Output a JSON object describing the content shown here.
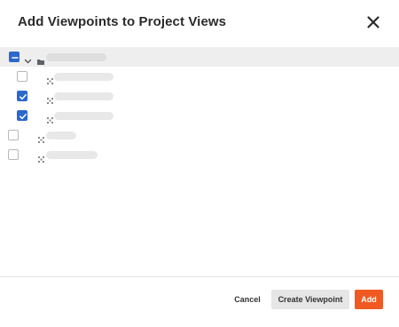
{
  "dialog": {
    "title": "Add Viewpoints to Project Views"
  },
  "tree": {
    "root": {
      "state": "indeterminate",
      "expanded": true,
      "icon": "folder-icon"
    },
    "children": [
      {
        "checked": false,
        "icon": "viewpoint-icon"
      },
      {
        "checked": true,
        "icon": "viewpoint-icon"
      },
      {
        "checked": true,
        "icon": "viewpoint-icon"
      }
    ],
    "siblings": [
      {
        "checked": false,
        "icon": "viewpoint-icon"
      },
      {
        "checked": false,
        "icon": "viewpoint-icon"
      }
    ]
  },
  "footer": {
    "cancel_label": "Cancel",
    "create_label": "Create Viewpoint",
    "add_label": "Add"
  },
  "colors": {
    "accent": "#2c68cc",
    "primary_button": "#f05a22",
    "secondary_button": "#e6e6e6"
  }
}
